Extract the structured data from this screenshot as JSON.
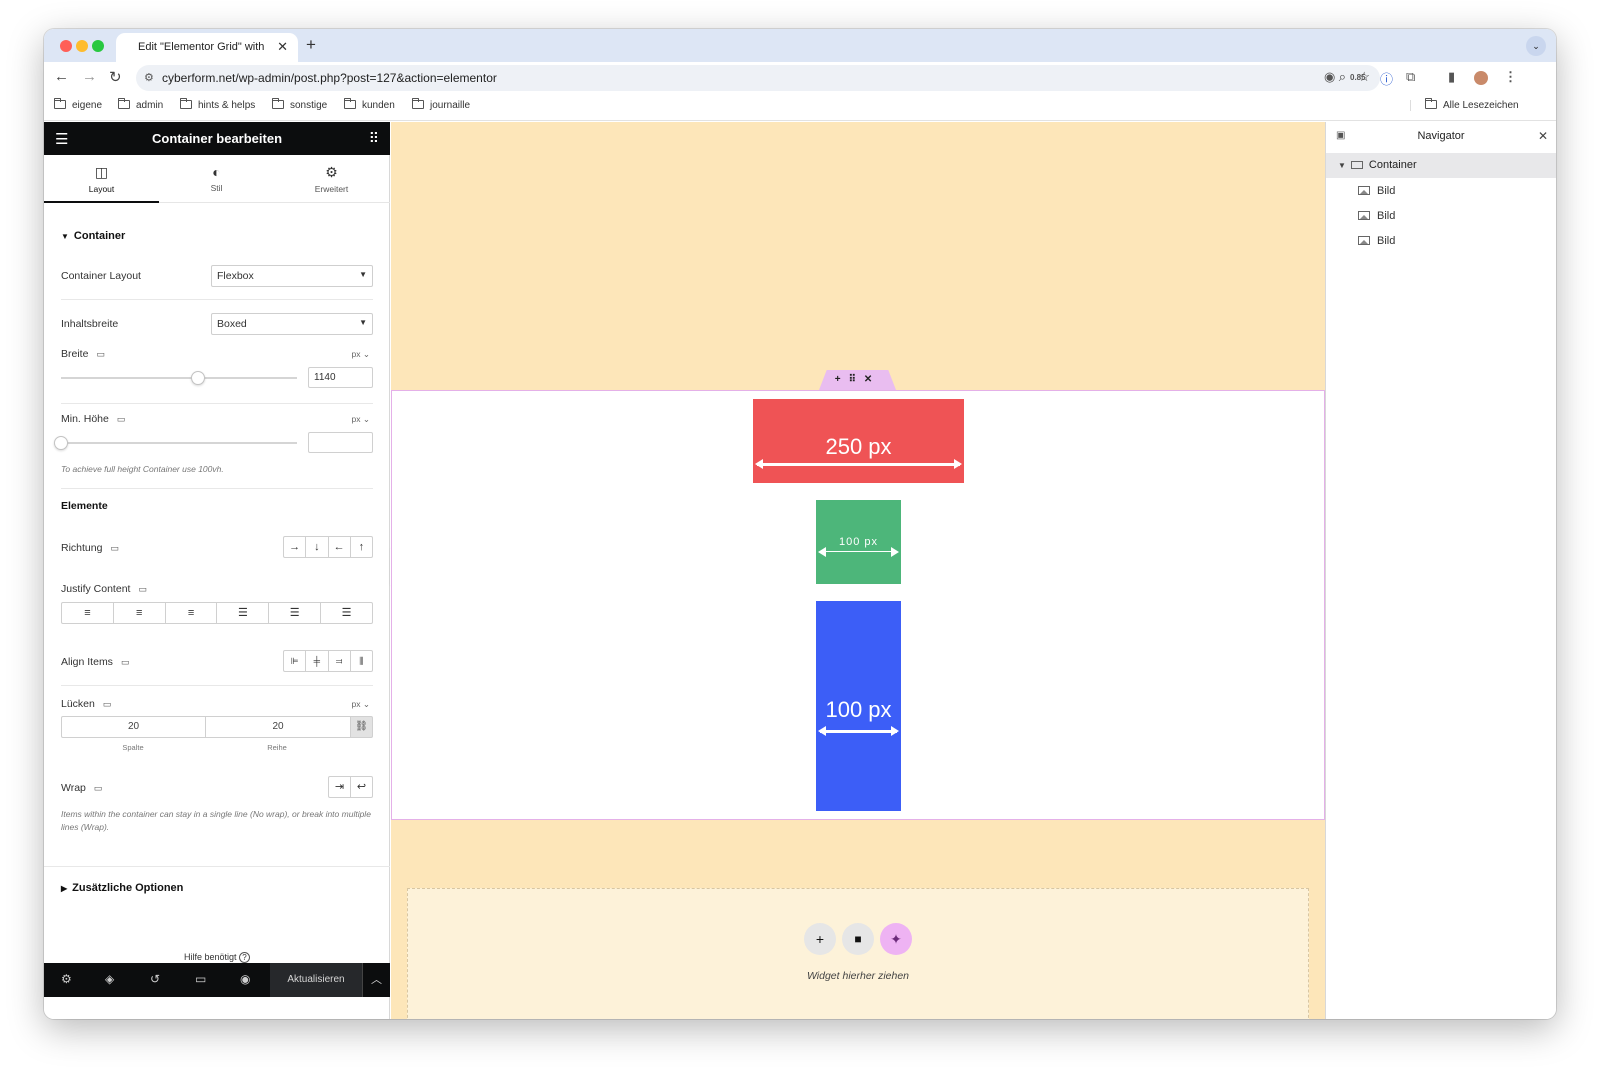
{
  "browser": {
    "tab_title": "Edit \"Elementor Grid\" with El",
    "new_tab": "+",
    "url": "cyberform.net/wp-admin/post.php?post=127&action=elementor",
    "zoom_ext_label": "0.85",
    "bookmarks": [
      "eigene",
      "admin",
      "hints & helps",
      "sonstige",
      "kunden",
      "journaille"
    ],
    "all_bookmarks": "Alle Lesezeichen"
  },
  "panel": {
    "title": "Container bearbeiten",
    "tabs": [
      {
        "label": "Layout",
        "icon": "columns-icon"
      },
      {
        "label": "Stil",
        "icon": "contrast-icon"
      },
      {
        "label": "Erweitert",
        "icon": "gear-icon"
      }
    ],
    "section_container": "Container",
    "container_layout": {
      "label": "Container Layout",
      "value": "Flexbox"
    },
    "content_width": {
      "label": "Inhaltsbreite",
      "value": "Boxed"
    },
    "width": {
      "label": "Breite",
      "unit": "px",
      "value": "1140"
    },
    "min_height": {
      "label": "Min. Höhe",
      "unit": "px",
      "value": "",
      "help": "To achieve full height Container use 100vh."
    },
    "section_elements": "Elemente",
    "direction": {
      "label": "Richtung",
      "options": [
        "→",
        "↓",
        "←",
        "↑"
      ]
    },
    "justify_content": {
      "label": "Justify Content"
    },
    "align_items": {
      "label": "Align Items"
    },
    "gaps": {
      "label": "Lücken",
      "unit": "px",
      "column": "20",
      "row": "20",
      "column_label": "Spalte",
      "row_label": "Reihe"
    },
    "wrap": {
      "label": "Wrap",
      "help": "Items within the container can stay in a single line (No wrap), or break into multiple lines (Wrap)."
    },
    "additional_options": "Zusätzliche Optionen",
    "help_needed": "Hilfe benötigt",
    "update_button": "Aktualisieren"
  },
  "canvas": {
    "boxes": [
      {
        "label": "250 px",
        "color": "#ef5355"
      },
      {
        "label": "100 px",
        "color": "#4db67a"
      },
      {
        "label": "100 px",
        "color": "#3c5ef7"
      }
    ],
    "drop_text": "Widget hierher ziehen",
    "background": "#fde6b9"
  },
  "navigator": {
    "title": "Navigator",
    "container": "Container",
    "items": [
      "Bild",
      "Bild",
      "Bild"
    ]
  }
}
